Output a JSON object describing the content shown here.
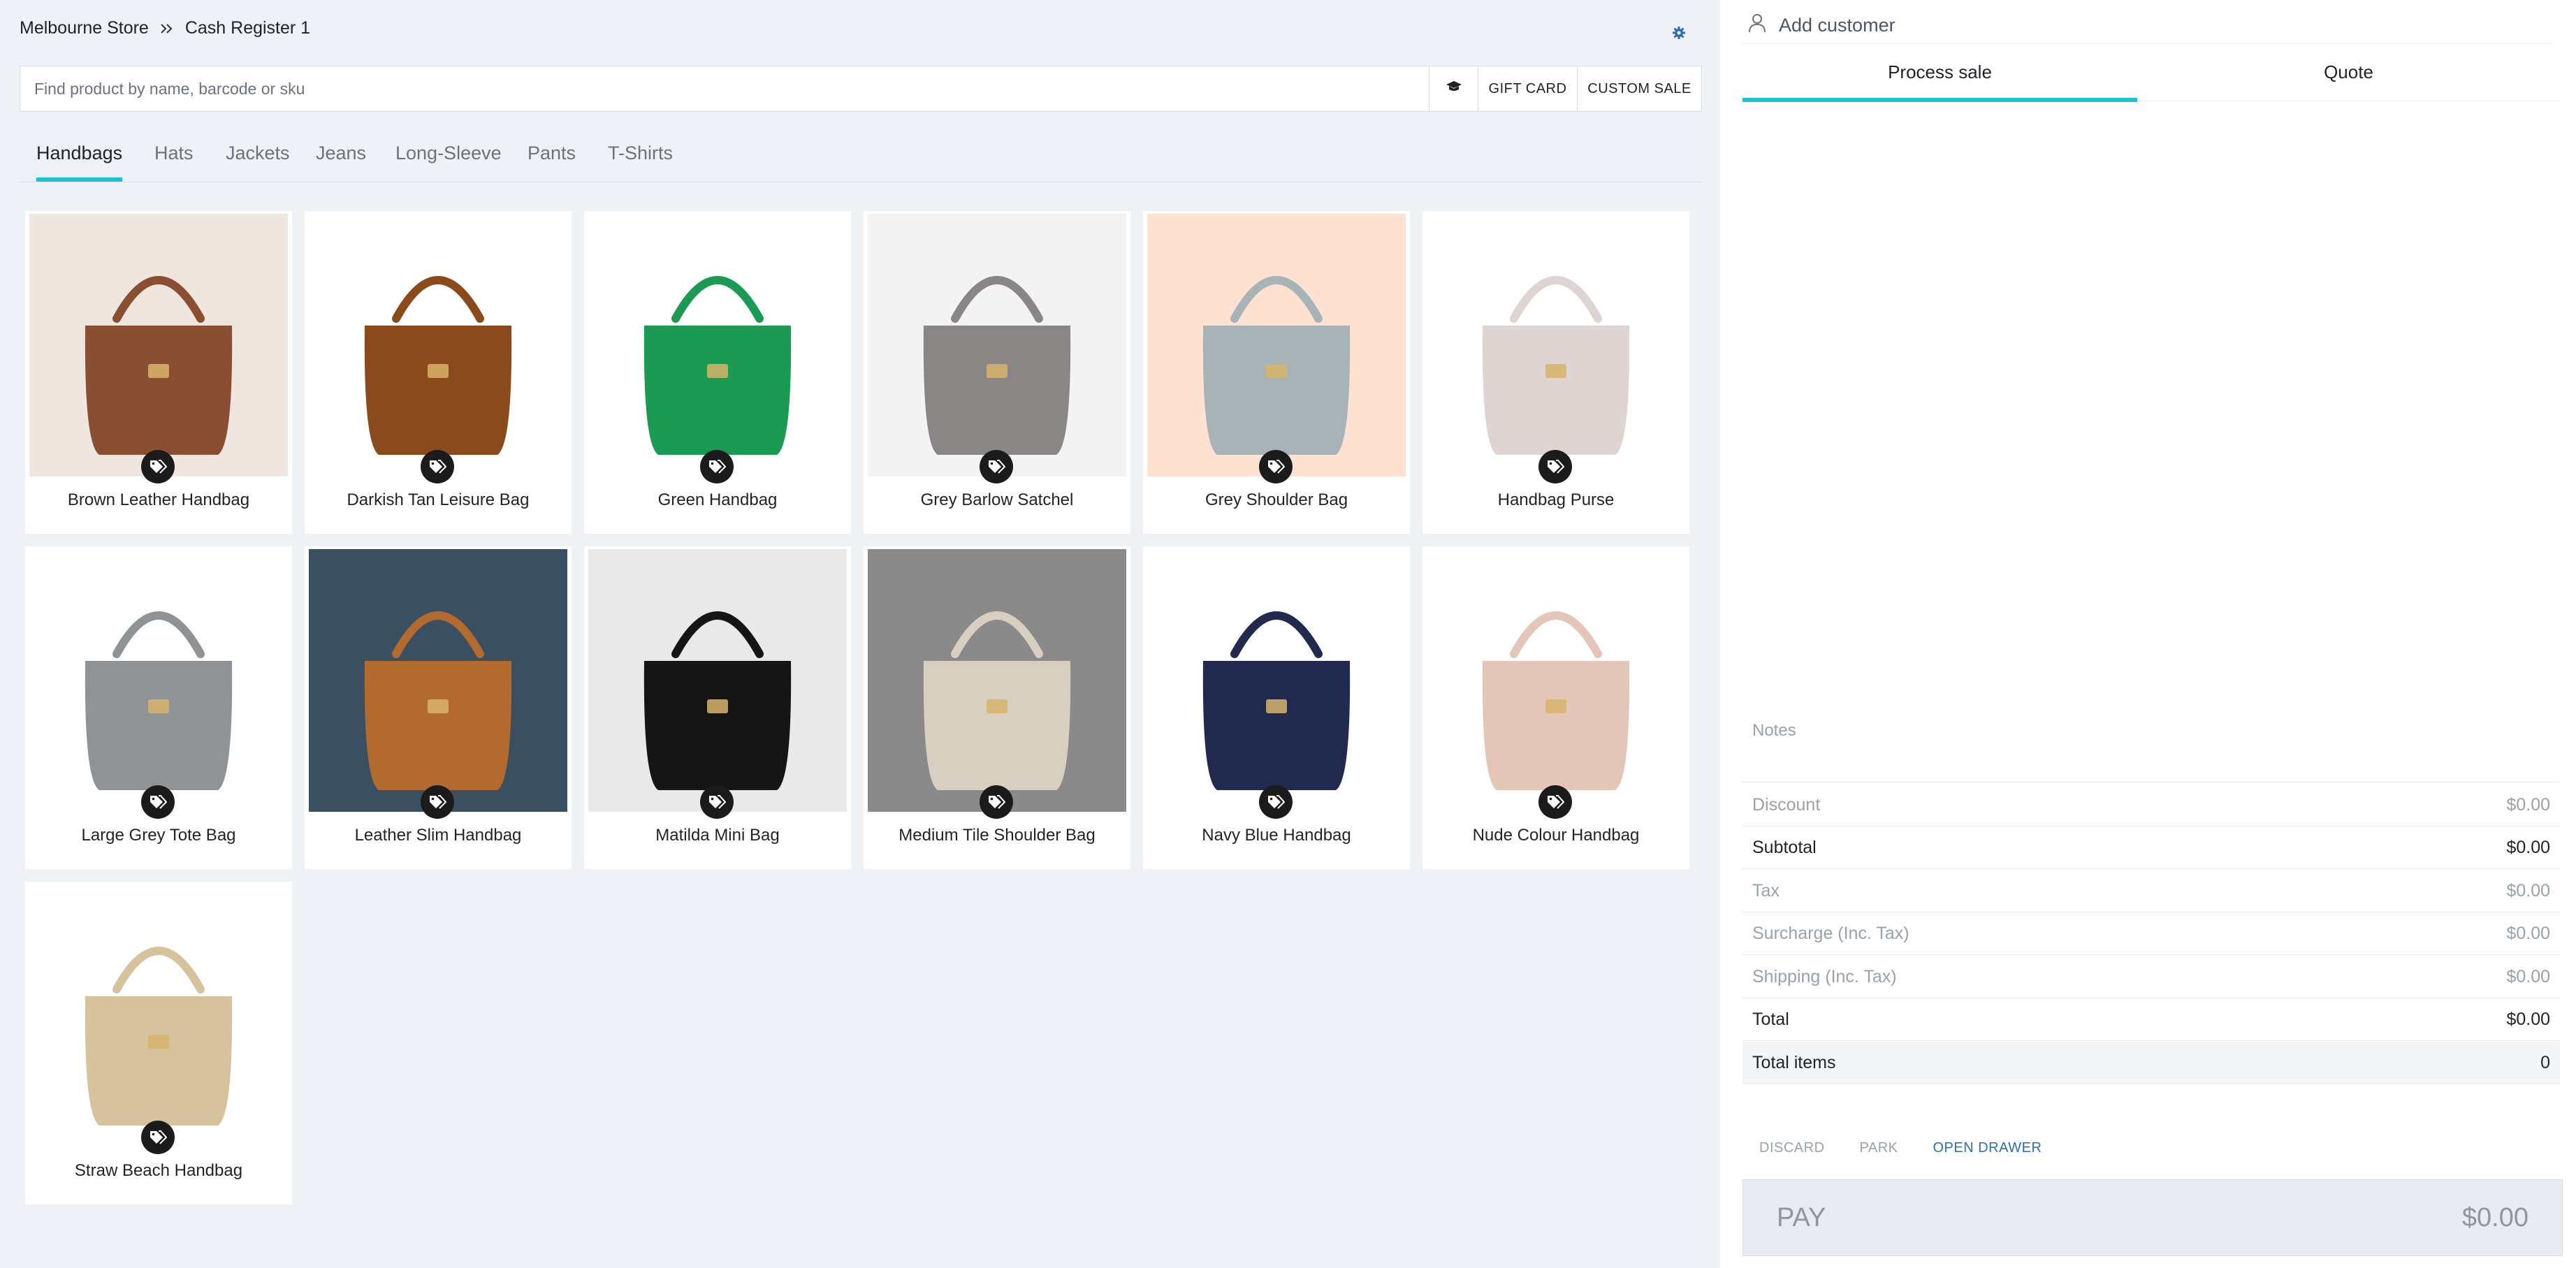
{
  "breadcrumb": {
    "store": "Melbourne Store",
    "register": "Cash Register 1"
  },
  "search": {
    "placeholder": "Find product by name, barcode or sku",
    "gift_card": "GIFT CARD",
    "custom_sale": "CUSTOM SALE"
  },
  "categories": [
    "Handbags",
    "Hats",
    "Jackets",
    "Jeans",
    "Long-Sleeve",
    "Pants",
    "T-Shirts"
  ],
  "active_category": "Handbags",
  "products": [
    {
      "name": "Brown Leather Handbag",
      "color": "#8a4f32",
      "bg": "#efe6df"
    },
    {
      "name": "Darkish Tan Leisure Bag",
      "color": "#8b4a1c",
      "bg": "#ffffff"
    },
    {
      "name": "Green Handbag",
      "color": "#1a9a52",
      "bg": "#ffffff"
    },
    {
      "name": "Grey Barlow Satchel",
      "color": "#8a8685",
      "bg": "#f3f3f3"
    },
    {
      "name": "Grey Shoulder Bag",
      "color": "#a7b3b6",
      "bg": "#fde2d2"
    },
    {
      "name": "Handbag Purse",
      "color": "#ded4d1",
      "bg": "#ffffff"
    },
    {
      "name": "Large Grey Tote Bag",
      "color": "#8f9396",
      "bg": "#ffffff"
    },
    {
      "name": "Leather Slim Handbag",
      "color": "#b26a2f",
      "bg": "#3a5060"
    },
    {
      "name": "Matilda Mini Bag",
      "color": "#151515",
      "bg": "#e9e9e9"
    },
    {
      "name": "Medium Tile Shoulder Bag",
      "color": "#d8cfc0",
      "bg": "#8a8a8a"
    },
    {
      "name": "Navy Blue Handbag",
      "color": "#22294f",
      "bg": "#ffffff"
    },
    {
      "name": "Nude Colour Handbag",
      "color": "#e4c6b8",
      "bg": "#ffffff"
    },
    {
      "name": "Straw Beach Handbag",
      "color": "#d6c29c",
      "bg": "#ffffff"
    }
  ],
  "customer": {
    "add_label": "Add customer"
  },
  "sale_tabs": [
    "Process sale",
    "Quote"
  ],
  "notes_placeholder": "Notes",
  "summary": {
    "discount": {
      "label": "Discount",
      "value": "$0.00"
    },
    "subtotal": {
      "label": "Subtotal",
      "value": "$0.00"
    },
    "tax": {
      "label": "Tax",
      "value": "$0.00"
    },
    "surcharge": {
      "label": "Surcharge (Inc. Tax)",
      "value": "$0.00"
    },
    "shipping": {
      "label": "Shipping (Inc. Tax)",
      "value": "$0.00"
    },
    "total": {
      "label": "Total",
      "value": "$0.00"
    },
    "total_items": {
      "label": "Total items",
      "value": "0"
    }
  },
  "actions": {
    "discard": "DISCARD",
    "park": "PARK",
    "open_drawer": "OPEN DRAWER"
  },
  "pay": {
    "label": "PAY",
    "amount": "$0.00"
  },
  "colors": {
    "accent": "#1ec2d4",
    "link": "#2f6db5",
    "muted": "#9aa1aa"
  }
}
